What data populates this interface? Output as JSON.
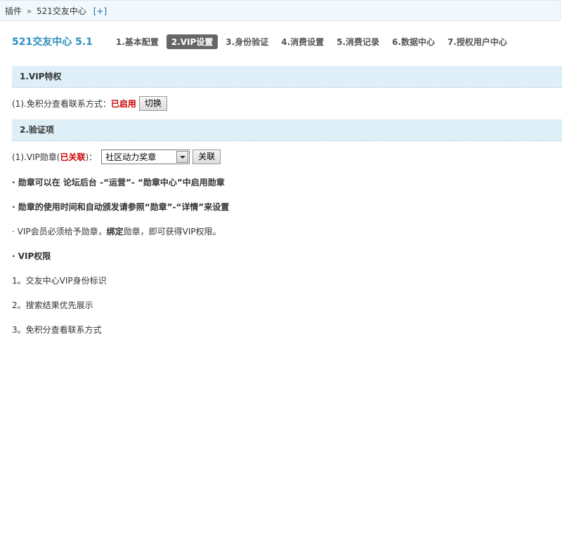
{
  "breadcrumb": {
    "root": "插件",
    "separator": "»",
    "current": "521交友中心",
    "add": "[+]"
  },
  "app": {
    "title": "521交友中心 5.1",
    "tabs": [
      {
        "label": "1.基本配置",
        "active": false
      },
      {
        "label": "2.VIP设置",
        "active": true
      },
      {
        "label": "3.身份验证",
        "active": false
      },
      {
        "label": "4.消费设置",
        "active": false
      },
      {
        "label": "5.消费记录",
        "active": false
      },
      {
        "label": "6.数据中心",
        "active": false
      },
      {
        "label": "7.授权用户中心",
        "active": false
      }
    ]
  },
  "vip_privilege": {
    "header": "1.VIP特权",
    "free_view_label": "(1).免积分查看联系方式：",
    "free_view_status": "已启用",
    "toggle_button": "切换"
  },
  "verification": {
    "header": "2.验证项",
    "medal_label_prefix": "(1).VIP勋章(",
    "medal_status": "已关联",
    "medal_label_suffix": ")：",
    "medal_selected": "社区动力奖章",
    "link_button": "关联",
    "note1": "· 勋章可以在 论坛后台 -“运营”- “勋章中心”中启用勋章",
    "note2": "· 勋章的使用时间和自动颁发请参照“勋章”-“详情”来设置",
    "note3_prefix": "· VIP会员必须给予勋章，",
    "note3_bold": "绑定",
    "note3_suffix": "勋章，即可获得VIP权限。",
    "rights_title": "· VIP权限",
    "rights": [
      "1。交友中心VIP身份标识",
      "2。搜索结果优先展示",
      "3。免积分查看联系方式"
    ]
  },
  "colors": {
    "accent_title": "#2b8fbf",
    "status_red": "#cc0000",
    "section_bg": "#deeff8",
    "active_tab_bg": "#666666"
  }
}
